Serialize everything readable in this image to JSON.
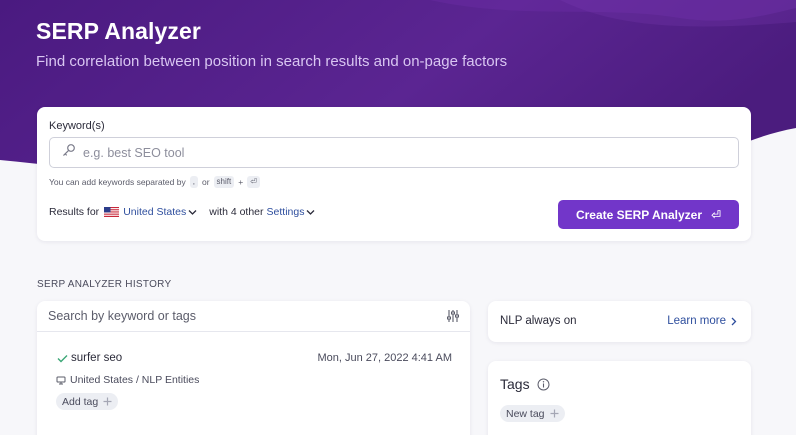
{
  "header": {
    "title": "SERP Analyzer",
    "subtitle": "Find correlation between position in search results and on-page factors"
  },
  "keyword_form": {
    "label": "Keyword(s)",
    "placeholder": "e.g. best SEO tool",
    "hint_prefix": "You can add keywords separated by",
    "hint_key_comma": ",",
    "hint_or": "or",
    "hint_key_shift": "shift",
    "hint_plus": "+",
    "hint_key_enter": "⏎",
    "results_for": "Results for",
    "country": "United States",
    "other_settings_prefix": "with 4 other",
    "settings_link": "Settings",
    "create_button": "Create SERP Analyzer",
    "create_button_icon": "⏎"
  },
  "history": {
    "heading": "SERP ANALYZER HISTORY",
    "search_placeholder": "Search by keyword or tags",
    "entries": [
      {
        "keyword": "surfer seo",
        "date": "Mon, Jun 27, 2022 4:41 AM",
        "meta": "United States / NLP Entities",
        "add_tag": "Add tag"
      }
    ]
  },
  "nlp": {
    "text": "NLP always on",
    "link": "Learn more"
  },
  "tags": {
    "title": "Tags",
    "new_tag": "New tag"
  },
  "colors": {
    "hero_dark": "#3f1670",
    "hero_mid": "#5a2390",
    "accent": "#7236c9",
    "link": "#2f4f9e",
    "check": "#3aa676"
  }
}
